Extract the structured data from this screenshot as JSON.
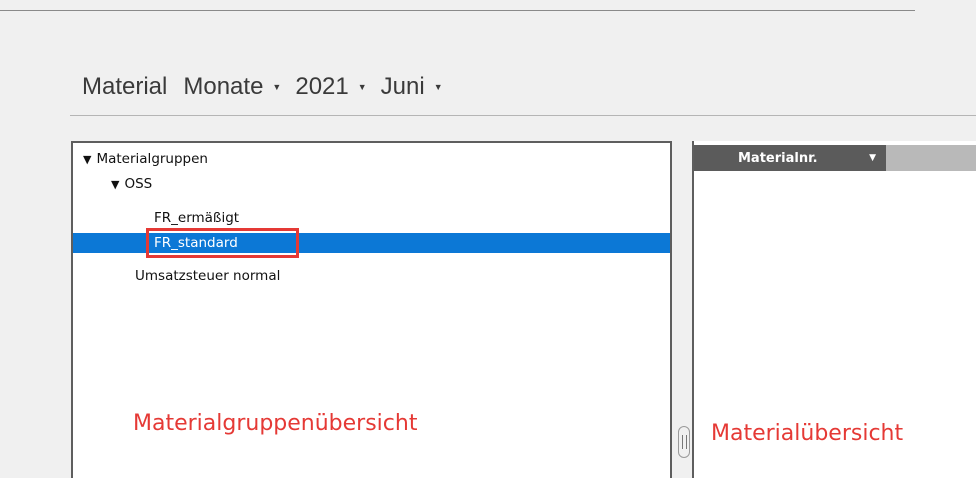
{
  "header": {
    "title": "Material",
    "filters": [
      {
        "label": "Monate"
      },
      {
        "label": "2021"
      },
      {
        "label": "Juni"
      }
    ]
  },
  "tree": {
    "items": [
      {
        "label": "Materialgruppen",
        "expanded": true,
        "level": 0
      },
      {
        "label": "OSS",
        "expanded": true,
        "level": 1
      },
      {
        "label": "FR_ermäßigt",
        "level": 2
      },
      {
        "label": "FR_standard",
        "level": 2,
        "selected": true
      },
      {
        "label": "Umsatzsteuer normal",
        "level": 1
      }
    ],
    "caption": "Materialgruppenübersicht"
  },
  "grid": {
    "columns": [
      {
        "label": "Materialnr."
      }
    ],
    "caption": "Materialübersicht"
  },
  "colors": {
    "selection": "#0c78d6",
    "annotation": "#e53935",
    "column_header": "#5b5b5b"
  }
}
